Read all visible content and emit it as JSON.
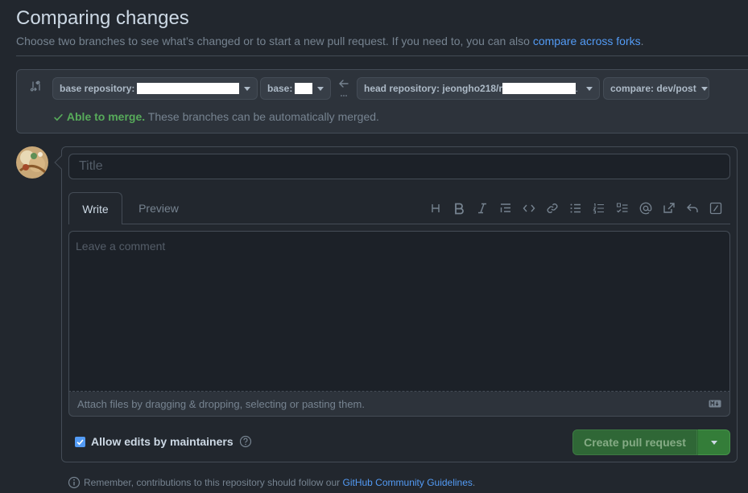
{
  "header": {
    "title": "Comparing changes",
    "subhead_text": "Choose two branches to see what’s changed or to start a new pull request. If you need to, you can also ",
    "subhead_link": "compare across forks",
    "subhead_end": "."
  },
  "range": {
    "base_repo_label": "base repository:",
    "base_label": "base:",
    "head_repo_label": "head repository:",
    "head_repo_value": "jeongho218/r",
    "head_repo_suffix": ".",
    "compare_label": "compare:",
    "compare_value": "dev/post",
    "merge_ok": "Able to merge.",
    "merge_text": " These branches can be automatically merged."
  },
  "composer": {
    "title_placeholder": "Title",
    "tab_write": "Write",
    "tab_preview": "Preview",
    "toolbar_icons": [
      "heading-icon",
      "bold-icon",
      "italic-icon",
      "quote-icon",
      "code-icon",
      "link-icon",
      "bulleted-list-icon",
      "numbered-list-icon",
      "task-list-icon",
      "mention-icon",
      "cross-reference-icon",
      "saved-replies-icon",
      "slash-commands-icon"
    ],
    "comment_placeholder": "Leave a comment",
    "attach_text": "Attach files by dragging & dropping, selecting or pasting them.",
    "allow_edits_label": "Allow edits by maintainers",
    "allow_edits_checked": true,
    "create_button": "Create pull request"
  },
  "footer": {
    "note": "Remember, contributions to this repository should follow our ",
    "link": "GitHub Community Guidelines",
    "end": "."
  },
  "colors": {
    "background": "#22272e",
    "accent_link": "#539bf5",
    "success": "#57ab5a",
    "primary_button": "#347d39"
  }
}
